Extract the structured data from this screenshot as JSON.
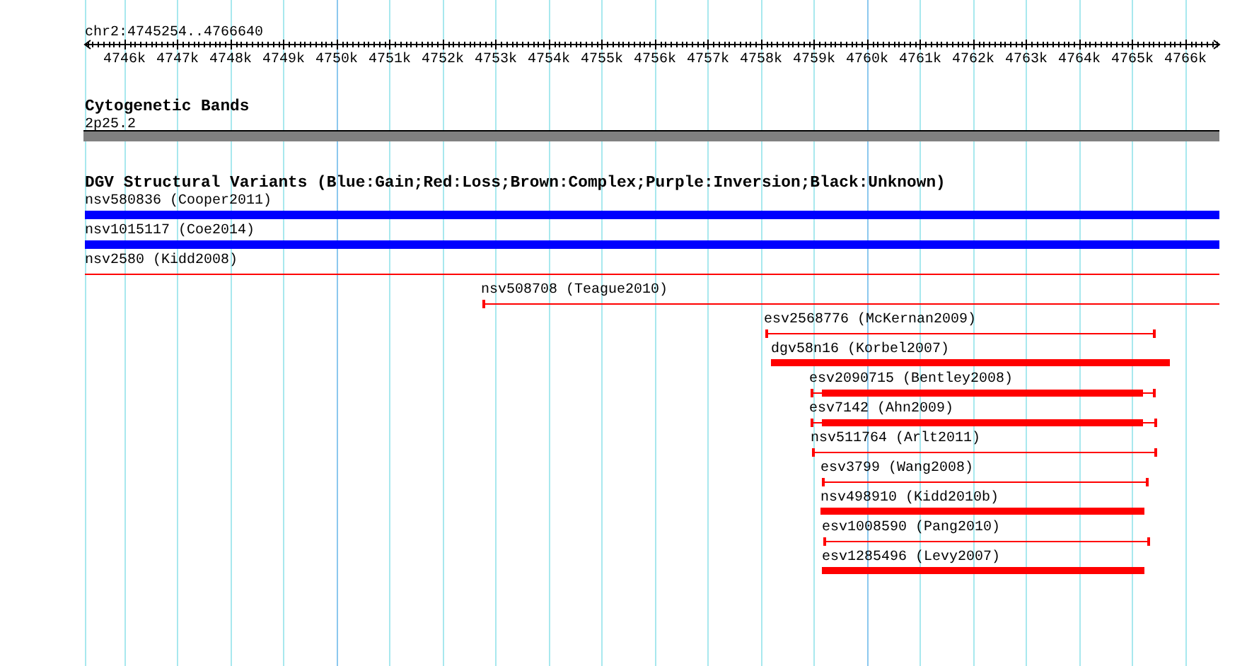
{
  "ruler": {
    "title": "chr2:4745254..4766640",
    "ticks": [
      "4746k",
      "4747k",
      "4748k",
      "4749k",
      "4750k",
      "4751k",
      "4752k",
      "4753k",
      "4754k",
      "4755k",
      "4756k",
      "4757k",
      "4758k",
      "4759k",
      "4760k",
      "4761k",
      "4762k",
      "4763k",
      "4764k",
      "4765k",
      "4766k"
    ]
  },
  "tracks": [
    {
      "title": "Cytogenetic Bands",
      "features": [
        {
          "label": "2p25.2",
          "kind": "band"
        }
      ]
    },
    {
      "title": "DGV Structural Variants (Blue:Gain;Red:Loss;Brown:Complex;Purple:Inversion;Black:Unknown)",
      "features": [
        {
          "label": "nsv580836 (Cooper2011)",
          "kind": "bar",
          "color": "#0000ff"
        },
        {
          "label": "nsv1015117 (Coe2014)",
          "kind": "bar",
          "color": "#0000ff"
        },
        {
          "label": "nsv2580 (Kidd2008)",
          "kind": "line",
          "color": "#ff0000"
        },
        {
          "label": "nsv508708 (Teague2010)",
          "kind": "interval",
          "color": "#ff0000"
        },
        {
          "label": "esv2568776 (McKernan2009)",
          "kind": "interval",
          "color": "#ff0000"
        },
        {
          "label": "dgv58n16 (Korbel2007)",
          "kind": "bar",
          "color": "#ff0000"
        },
        {
          "label": "esv2090715 (Bentley2008)",
          "kind": "whisker-bar",
          "color": "#ff0000"
        },
        {
          "label": "esv7142 (Ahn2009)",
          "kind": "whisker-bar",
          "color": "#ff0000"
        },
        {
          "label": "nsv511764 (Arlt2011)",
          "kind": "interval",
          "color": "#ff0000"
        },
        {
          "label": "esv3799 (Wang2008)",
          "kind": "interval",
          "color": "#ff0000"
        },
        {
          "label": "nsv498910 (Kidd2010b)",
          "kind": "bar",
          "color": "#ff0000"
        },
        {
          "label": "esv1008590 (Pang2010)",
          "kind": "interval",
          "color": "#ff0000"
        },
        {
          "label": "esv1285496 (Levy2007)",
          "kind": "bar",
          "color": "#ff0000"
        }
      ]
    }
  ]
}
